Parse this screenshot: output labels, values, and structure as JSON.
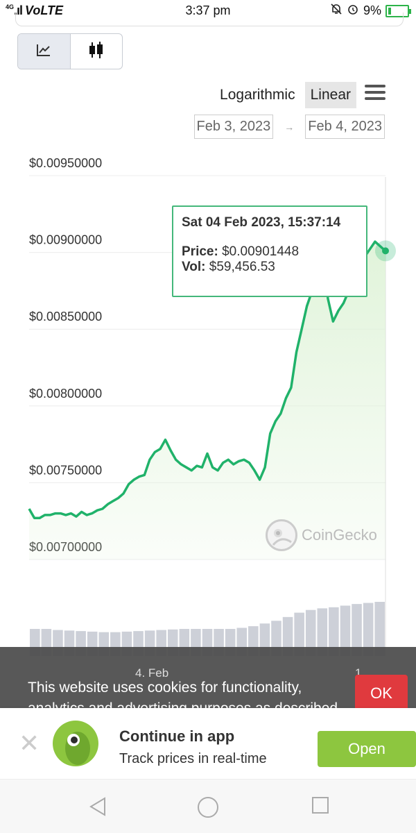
{
  "status_bar": {
    "network": "4G",
    "carrier": "VoLTE",
    "time": "3:37 pm",
    "battery": "9%"
  },
  "chart_controls": {
    "line_icon": "line-chart-icon",
    "candle_icon": "candlestick-icon",
    "log_label": "Logarithmic",
    "linear_label": "Linear",
    "menu_icon": "hamburger-menu-icon",
    "date_from": "Feb 3, 2023",
    "date_arrow": "→",
    "date_to": "Feb 4, 2023"
  },
  "chart_data": {
    "type": "area",
    "ytick_labels": [
      "$0.00950000",
      "$0.00900000",
      "$0.00850000",
      "$0.00800000",
      "$0.00750000",
      "$0.00700000"
    ],
    "ylim": [
      0.007,
      0.0095
    ],
    "xtick_labels": [
      "4. Feb",
      "1"
    ],
    "series": [
      {
        "values": [
          0.00733,
          0.00727,
          0.00727,
          0.00729,
          0.00729,
          0.0073,
          0.0073,
          0.00729,
          0.0073,
          0.00728,
          0.00731,
          0.00729,
          0.0073,
          0.00732,
          0.00733,
          0.00736,
          0.00738,
          0.0074,
          0.00743,
          0.00749,
          0.00752,
          0.00754,
          0.00755,
          0.00765,
          0.0077,
          0.00772,
          0.00778,
          0.00771,
          0.00765,
          0.00762,
          0.0076,
          0.00758,
          0.00761,
          0.0076,
          0.00769,
          0.0076,
          0.00758,
          0.00763,
          0.00765,
          0.00762,
          0.00764,
          0.00765,
          0.00763,
          0.00758,
          0.00752,
          0.0076,
          0.00782,
          0.0079,
          0.00795,
          0.00805,
          0.00812,
          0.00835,
          0.0085,
          0.00865,
          0.00875,
          0.00885,
          0.0091,
          0.0087,
          0.00855,
          0.00862,
          0.00867,
          0.00875,
          0.0089,
          0.00898,
          0.00897,
          0.00902,
          0.00907,
          0.00904,
          0.00901
        ]
      }
    ],
    "volume_values": [
      0.5,
      0.5,
      0.48,
      0.47,
      0.46,
      0.45,
      0.44,
      0.44,
      0.45,
      0.46,
      0.47,
      0.48,
      0.49,
      0.5,
      0.5,
      0.5,
      0.5,
      0.5,
      0.52,
      0.55,
      0.6,
      0.65,
      0.72,
      0.8,
      0.85,
      0.88,
      0.9,
      0.93,
      0.96,
      0.98,
      1.0
    ],
    "tooltip": {
      "date": "Sat 04 Feb 2023, 15:37:14",
      "price_label": "Price:",
      "price_value": "$0.00901448",
      "vol_label": "Vol:",
      "vol_value": "$59,456.53"
    },
    "watermark": "CoinGecko",
    "line_color": "#20b26a",
    "fill_color": "#dff3d8"
  },
  "cookie": {
    "text": "This website uses cookies for functionality, analytics and advertising purposes as described",
    "ok_label": "OK"
  },
  "app_banner": {
    "close_icon": "close-icon",
    "title": "Continue in app",
    "subtitle": "Track prices in real-time",
    "open_label": "Open"
  },
  "nav": {
    "back": "back-icon",
    "home": "home-icon",
    "recents": "recents-icon"
  }
}
